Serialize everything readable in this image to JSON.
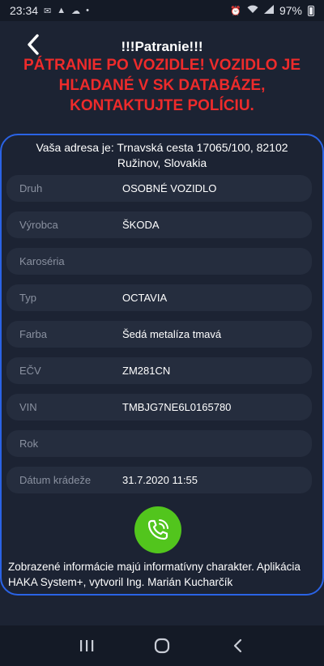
{
  "status_bar": {
    "time": "23:34",
    "battery": "97%"
  },
  "header": {
    "title": "!!!Patranie!!!",
    "alert": "PÁTRANIE PO VOZIDLE! VOZIDLO JE HĽADANÉ V SK DATABÁZE, KONTAKTUJTE POLÍCIU."
  },
  "address": "Vaša adresa je: Trnavská cesta 17065/100, 82102 Ružinov, Slovakia",
  "rows": [
    {
      "label": "Druh",
      "value": "OSOBNÉ VOZIDLO"
    },
    {
      "label": "Výrobca",
      "value": "ŠKODA"
    },
    {
      "label": "Karoséria",
      "value": ""
    },
    {
      "label": "Typ",
      "value": "OCTAVIA"
    },
    {
      "label": "Farba",
      "value": "Šedá metalíza tmavá"
    },
    {
      "label": "EČV",
      "value": "ZM281CN"
    },
    {
      "label": "VIN",
      "value": "TMBJG7NE6L0165780"
    },
    {
      "label": "Rok",
      "value": ""
    },
    {
      "label": "Dátum krádeže",
      "value": "31.7.2020 11:55"
    }
  ],
  "disclaimer": "Zobrazené informácie majú informatívny charakter. Aplikácia HAKA System+, vytvoril Ing. Marián Kucharčík",
  "colors": {
    "background": "#1c2333",
    "alert": "#ee2b2b",
    "panel_border": "#2a63e6",
    "call_button": "#52c51d",
    "row_bg": "#252d3e"
  },
  "icons": {
    "back": "chevron-left-icon",
    "call": "phone-call-icon",
    "nav_recent": "recent-apps-icon",
    "nav_home": "home-icon",
    "nav_back": "back-icon"
  }
}
